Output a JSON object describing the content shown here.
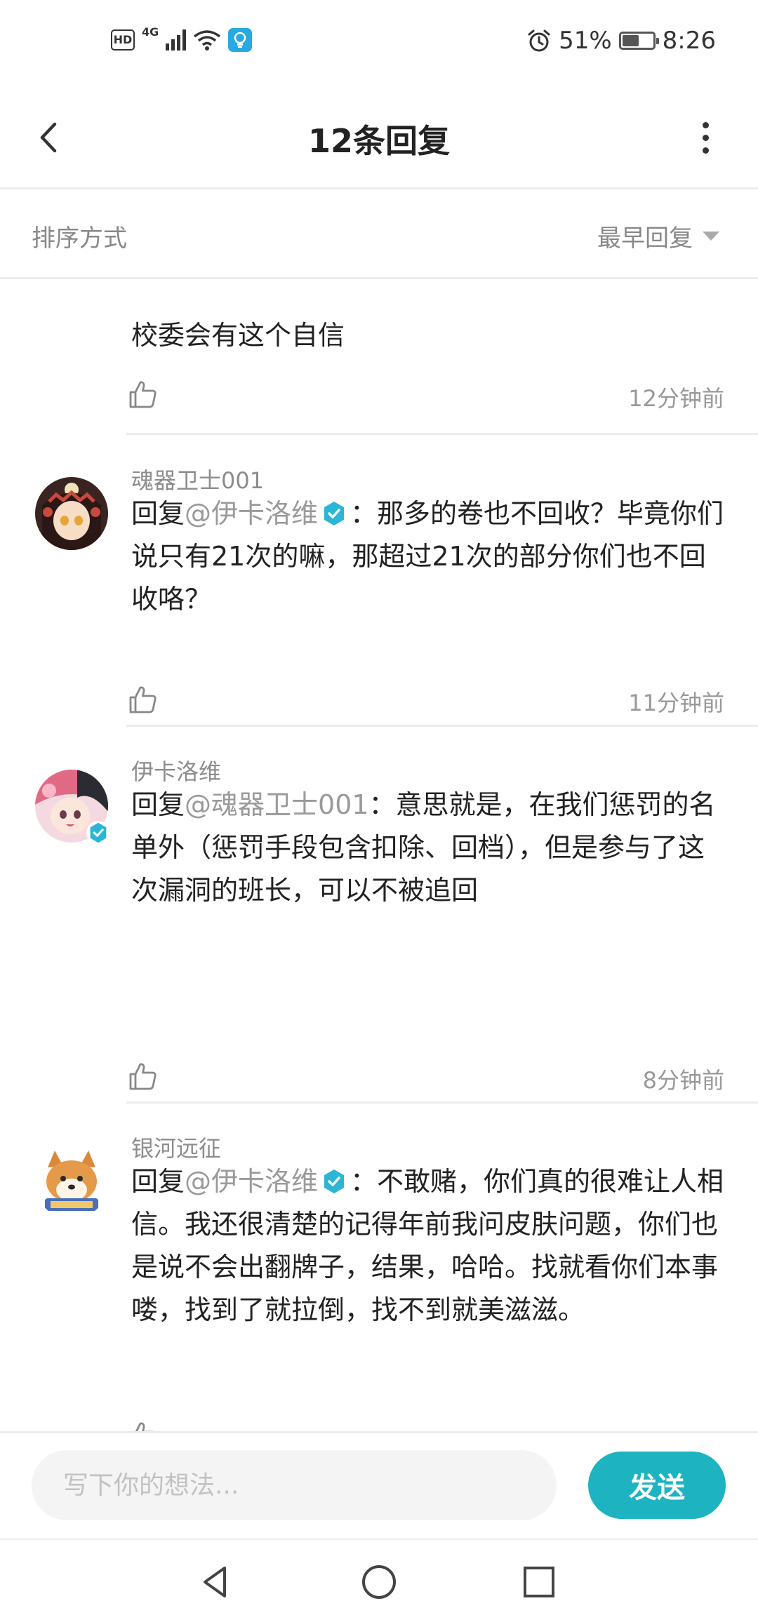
{
  "status_bar": {
    "hd": "HD",
    "network": "4G",
    "battery_percent": "51%",
    "battery_level": 0.51,
    "time": "8:26"
  },
  "header": {
    "title": "12条回复"
  },
  "sort": {
    "label": "排序方式",
    "selected": "最早回复"
  },
  "replies": [
    {
      "content": "校委会有这个自信",
      "time": "12分钟前"
    },
    {
      "username": "魂器卫士001",
      "reply_prefix": "回复",
      "reply_to": "@伊卡洛维",
      "text": "：那多的卷也不回收？毕竟你们说只有21次的嘛，那超过21次的部分你们也不回收咯？",
      "time": "11分钟前"
    },
    {
      "username": "伊卡洛维",
      "reply_prefix": "回复",
      "reply_to": "@魂器卫士001",
      "text": "：意思就是，在我们惩罚的名单外（惩罚手段包含扣除、回档），但是参与了这次漏洞的班长，可以不被追回",
      "time": "8分钟前"
    },
    {
      "username": "银河远征",
      "reply_prefix": "回复",
      "reply_to": "@伊卡洛维",
      "text": "：不敢赌，你们真的很难让人相信。我还很清楚的记得年前我问皮肤问题，你们也是说不会出翻牌子，结果，哈哈。找就看你们本事喽，找到了就拉倒，找不到就美滋滋。"
    }
  ],
  "input": {
    "placeholder": "写下你的想法...",
    "value": ""
  },
  "send_label": "发送",
  "colors": {
    "accent": "#1db3c1",
    "verified": "#2bb5d6",
    "muted_text": "#999999",
    "divider": "#ececec"
  },
  "icons": {
    "back": "chevron-left-icon",
    "more": "more-vertical-icon",
    "like": "thumbs-up-icon",
    "verified": "verified-badge-icon",
    "nav_back": "triangle-back-icon",
    "nav_home": "circle-home-icon",
    "nav_recents": "square-recents-icon"
  }
}
